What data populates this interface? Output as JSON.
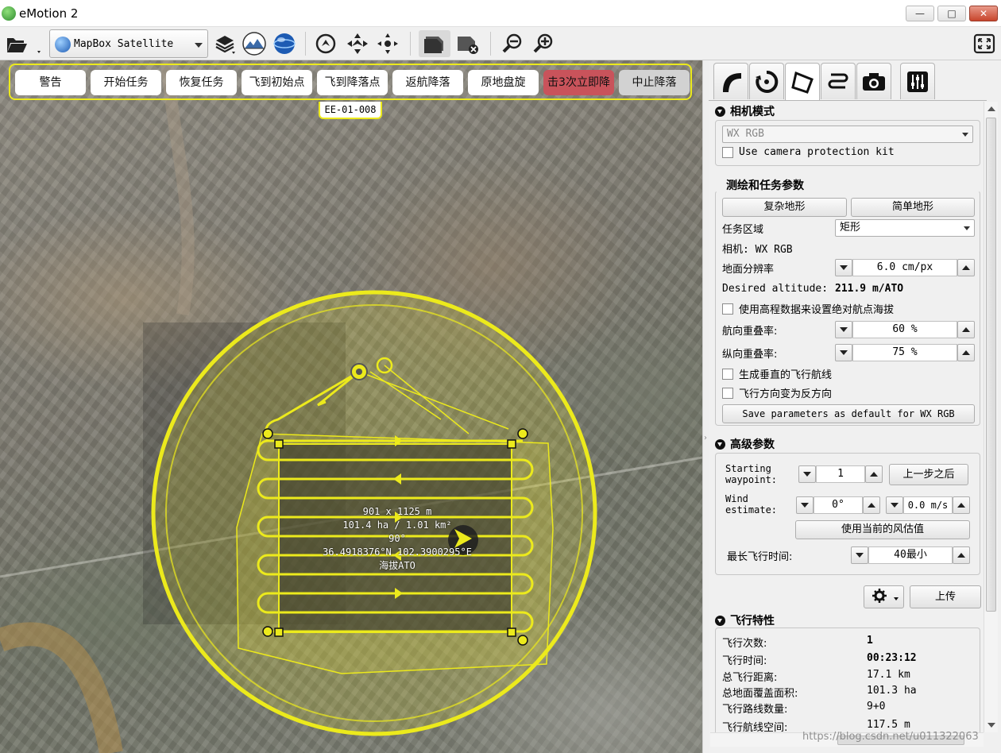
{
  "window": {
    "title": "eMotion 2",
    "min": "—",
    "max": "□",
    "close": "✕"
  },
  "toolbar": {
    "map_source": "MapBox Satellite",
    "icons": [
      "folder-open-icon",
      "layers-icon",
      "terrain-icon",
      "globe-icon",
      "takeoff-icon",
      "center-drone-icon",
      "recenter-icon",
      "drone-camera-icon",
      "drone-remove-icon",
      "zoom-out-icon",
      "zoom-in-icon",
      "fullscreen-icon"
    ]
  },
  "commands": {
    "warning": "警告",
    "start_mission": "开始任务",
    "resume_mission": "恢复任务",
    "fly_to_start": "飞到初始点",
    "fly_to_landing": "飞到降落点",
    "return_land": "返航降落",
    "loiter": "原地盘旋",
    "triple_click_land": "击3次立即降",
    "abort_landing": "中止降落"
  },
  "drone_id": "EE-01-008",
  "map_info": {
    "size": "901 x 1125 m",
    "area": "101.4 ha / 1.01 km²",
    "heading": "90°",
    "coords": "36.4918376°N 102.3900295°E",
    "altitude": "海拔ATO"
  },
  "camera": {
    "header": "相机模式",
    "model": "WX RGB",
    "protection_kit": "Use camera protection kit"
  },
  "mapping": {
    "header": "测绘和任务参数",
    "complex_terrain": "复杂地形",
    "simple_terrain": "简单地形",
    "area_label": "任务区域",
    "area_value": "矩形",
    "camera_line": "相机: WX RGB",
    "gsd_label": "地面分辨率",
    "gsd_value": "6.0 cm/px",
    "altitude_label": "Desired altitude:",
    "altitude_value": "211.9 m/ATO",
    "use_elevation": "使用高程数据来设置绝对航点海拔",
    "lateral_overlap_label": "航向重叠率:",
    "lateral_overlap_value": "60 %",
    "longitudinal_overlap_label": "纵向重叠率:",
    "longitudinal_overlap_value": "75 %",
    "perpendicular_lines": "生成垂直的飞行航线",
    "reverse_direction": "飞行方向变为反方向",
    "save_default": "Save parameters as default for WX RGB"
  },
  "advanced": {
    "header": "高级参数",
    "starting_wp_label_1": "Starting",
    "starting_wp_label_2": "waypoint:",
    "starting_wp_value": "1",
    "after_previous": "上一步之后",
    "wind_label_1": "Wind",
    "wind_label_2": "estimate:",
    "wind_dir": "0°",
    "wind_speed": "0.0 m/s",
    "use_current_wind": "使用当前的风估值",
    "max_time_label": "最长飞行时间:",
    "max_time_value": "40最小"
  },
  "actions": {
    "upload": "上传"
  },
  "flight": {
    "header": "飞行特性",
    "rows": [
      {
        "label": "飞行次数:",
        "value": "1",
        "bold": true
      },
      {
        "label": "飞行时间:",
        "value": "00:23:12",
        "bold": true
      },
      {
        "label": "总飞行距离:",
        "value": "17.1 km",
        "bold": false
      },
      {
        "label": "总地面覆盖面积:",
        "value": "101.3 ha",
        "bold": false
      },
      {
        "label": "飞行路线数量:",
        "value": "9+0",
        "bold": false
      },
      {
        "label": "飞行航线空间:",
        "value": "117.5 m",
        "bold": false
      }
    ]
  },
  "watermark": "https://blog.csdn.net/u011322063",
  "colors": {
    "accent": "#ecea1c",
    "danger": "#c9535b"
  }
}
